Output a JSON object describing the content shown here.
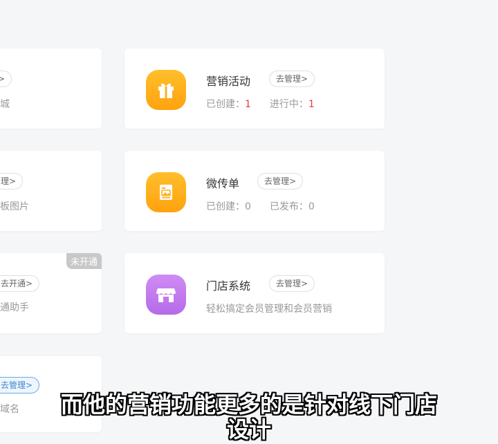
{
  "left_cards": [
    {
      "tag": "理>",
      "sub": "城"
    },
    {
      "tag": "理>",
      "sub": "板图片"
    },
    {
      "tag": "去开通>",
      "sub": "通助手",
      "ribbon": "未开通"
    },
    {
      "tag": "去管理>",
      "sub": "域名"
    }
  ],
  "cards": [
    {
      "title": "营销活动",
      "button": "去管理>",
      "stat1_label": "已创建：",
      "stat1_value": "1",
      "stat2_label": "进行中：",
      "stat2_value": "1",
      "icon": "gift-icon"
    },
    {
      "title": "微传单",
      "button": "去管理>",
      "stat1_label": "已创建：",
      "stat1_value": "0",
      "stat2_label": "已发布：",
      "stat2_value": "0",
      "icon": "flyer-icon"
    },
    {
      "title": "门店系统",
      "button": "去管理>",
      "description": "轻松搞定会员管理和会员营销",
      "icon": "store-icon"
    }
  ],
  "caption_line1": "而他的营销功能更多的是针对线下门店",
  "caption_line2": "设计",
  "colors": {
    "accent_orange": "#ffa20f",
    "accent_purple": "#b66ae9",
    "count_red": "#e03a3a"
  }
}
